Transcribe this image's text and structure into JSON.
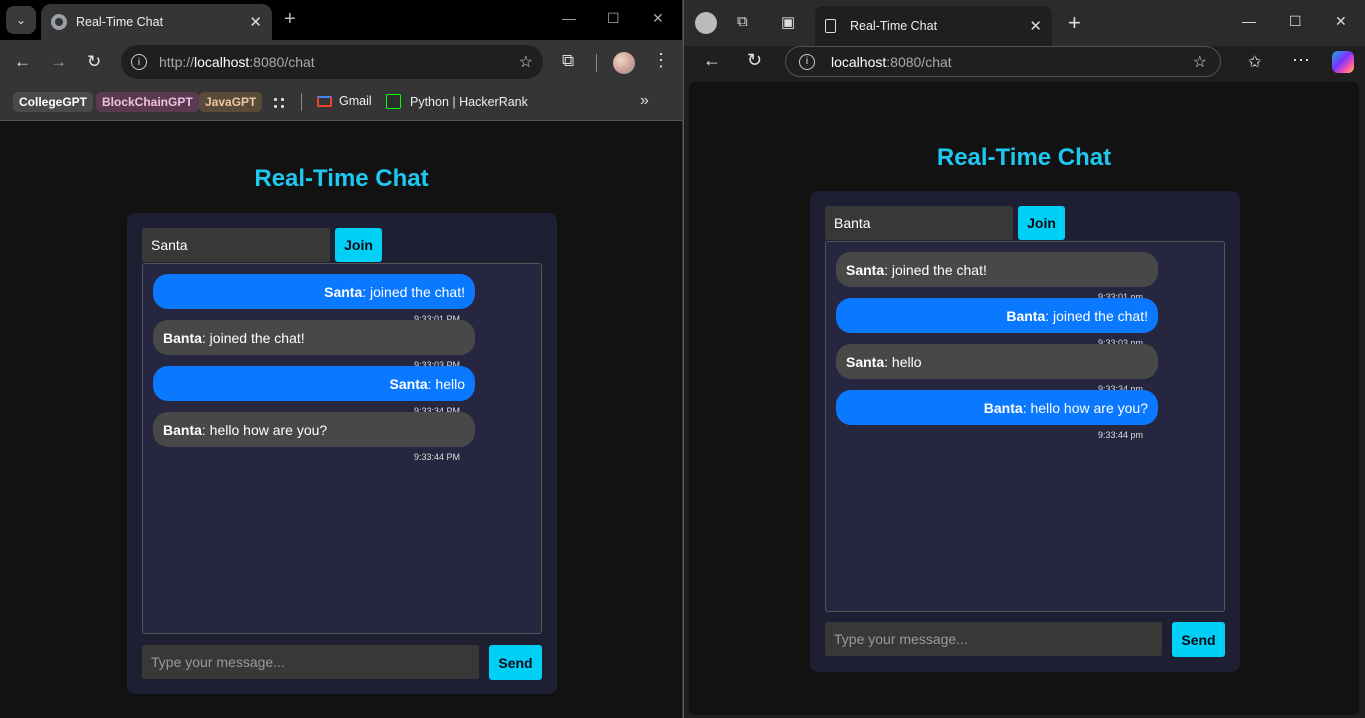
{
  "left_browser": {
    "tab_title": "Real-Time Chat",
    "url_prefix": "http://",
    "url_host": "localhost",
    "url_rest": ":8080/chat",
    "bookmarks": [
      {
        "label": "CollegeGPT",
        "bg": "#4a4a4a",
        "fg": "#ffffff"
      },
      {
        "label": "BlockChainGPT",
        "bg": "#5a3a50",
        "fg": "#f0c0e0"
      },
      {
        "label": "JavaGPT",
        "bg": "#5a4a3a",
        "fg": "#f0c8a0"
      }
    ],
    "gmail": "Gmail",
    "hackerrank": "Python | HackerRank"
  },
  "right_browser": {
    "tab_title": "Real-Time Chat",
    "url_host": "localhost",
    "url_rest": ":8080/chat"
  },
  "left_app": {
    "title": "Real-Time Chat",
    "username": "Santa",
    "join_label": "Join",
    "placeholder": "Type your message...",
    "send_label": "Send",
    "messages": [
      {
        "user": "Santa",
        "text": ": joined the chat!",
        "time": "9:33:01 PM",
        "self": true
      },
      {
        "user": "Banta",
        "text": ": joined the chat!",
        "time": "9:33:03 PM",
        "self": false
      },
      {
        "user": "Santa",
        "text": ": hello",
        "time": "9:33:34 PM",
        "self": true
      },
      {
        "user": "Banta",
        "text": ": hello how are you?",
        "time": "9:33:44 PM",
        "self": false
      }
    ]
  },
  "right_app": {
    "title": "Real-Time Chat",
    "username": "Banta",
    "join_label": "Join",
    "placeholder": "Type your message...",
    "send_label": "Send",
    "messages": [
      {
        "user": "Santa",
        "text": ": joined the chat!",
        "time": "9:33:01 pm",
        "self": false
      },
      {
        "user": "Banta",
        "text": ": joined the chat!",
        "time": "9:33:03 pm",
        "self": true
      },
      {
        "user": "Santa",
        "text": ": hello",
        "time": "9:33:34 pm",
        "self": false
      },
      {
        "user": "Banta",
        "text": ": hello how are you?",
        "time": "9:33:44 pm",
        "self": true
      }
    ]
  },
  "colors": {
    "accent": "#00d0f5",
    "title": "#1ec8f0",
    "self_bubble": "#0a78ff",
    "other_bubble": "#484848",
    "card": "#1f1f33"
  }
}
